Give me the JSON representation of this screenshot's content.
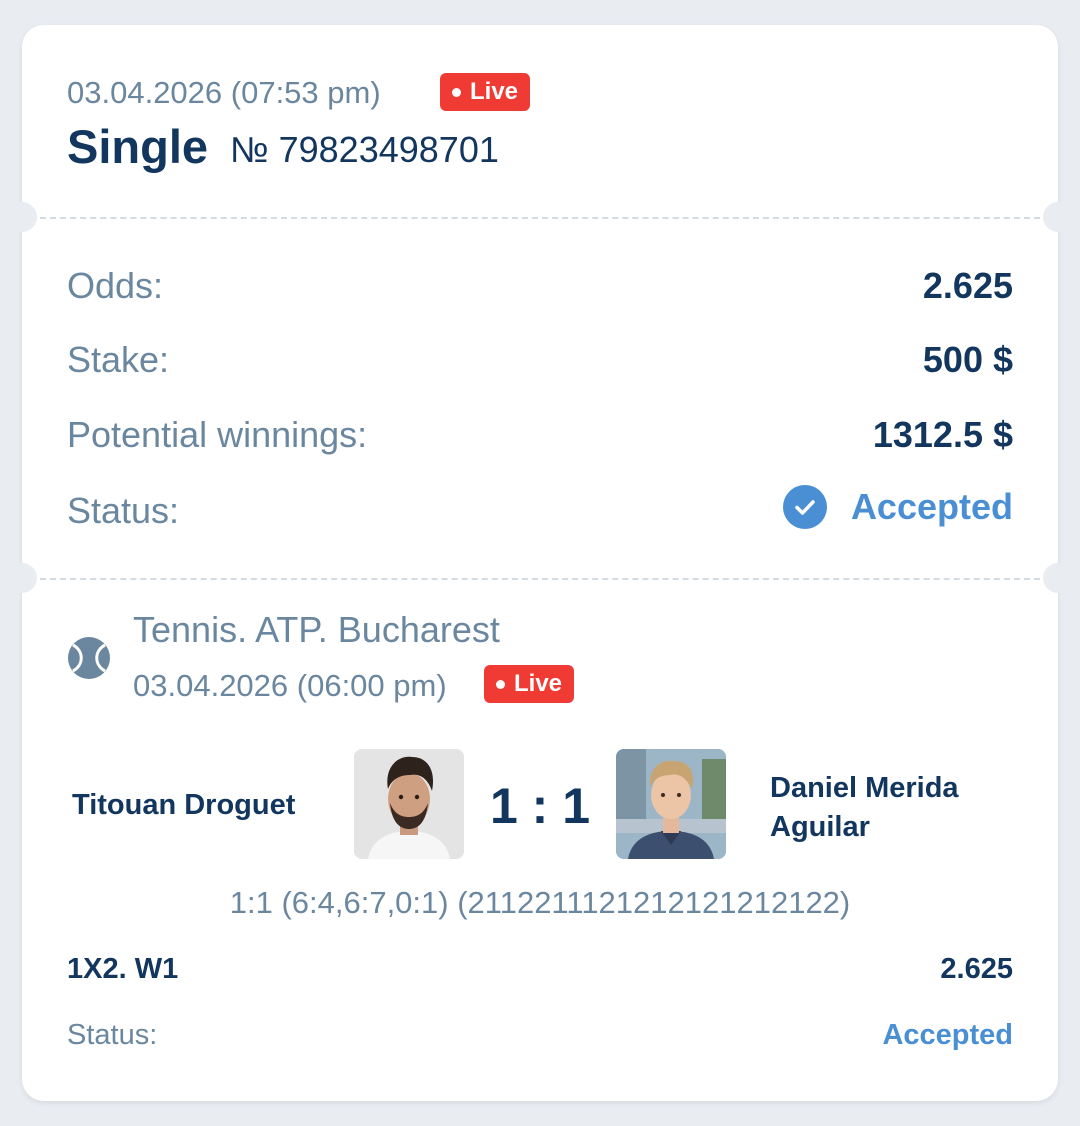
{
  "header": {
    "date": "03.04.2026 (07:53 pm)",
    "live_label": "Live",
    "bet_type": "Single",
    "bet_number": "№ 79823498701"
  },
  "details": {
    "odds_label": "Odds:",
    "odds_value": "2.625",
    "stake_label": "Stake:",
    "stake_value": "500 $",
    "potential_label": "Potential winnings:",
    "potential_value": "1312.5 $",
    "status_label": "Status:",
    "status_value": "Accepted"
  },
  "event": {
    "sport_icon": "tennis-ball-icon",
    "league": "Tennis. ATP. Bucharest",
    "date": "03.04.2026 (06:00 pm)",
    "live_label": "Live",
    "player1": "Titouan Droguet",
    "player2": "Daniel Merida Aguilar",
    "score": "1 : 1",
    "sets_detail": "1:1 (6:4,6:7,0:1) (2112211121212121212122)",
    "market": "1X2. W1",
    "market_odds": "2.625",
    "status_label": "Status:",
    "status_value": "Accepted"
  },
  "colors": {
    "page_bg": "#e9edf2",
    "primary_text": "#12365e",
    "secondary_text": "#6b879f",
    "accent": "#4a8fd3",
    "live_badge": "#ef3b33"
  }
}
